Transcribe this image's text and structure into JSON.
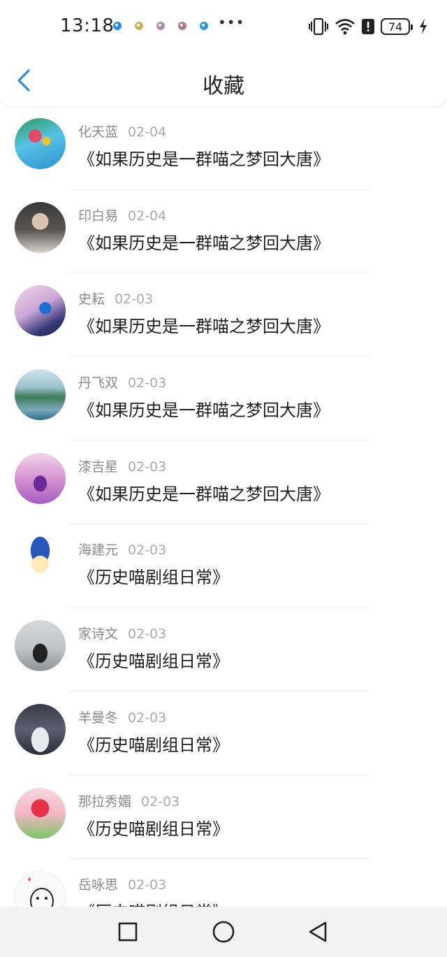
{
  "status_bar": {
    "time": "13:18",
    "overflow": "•••",
    "battery": "74",
    "notification_colors": [
      "#2a8fd6",
      "#c8b15a",
      "#a88ea8",
      "#b07a8a",
      "#2a9ad6"
    ]
  },
  "header": {
    "title": "收藏",
    "back_icon": "chevron-left-icon",
    "accent": "#2f8ee6"
  },
  "favorites": [
    {
      "user": "化天蓝",
      "date": "02-04",
      "book": "《如果历史是一群喵之梦回大唐》"
    },
    {
      "user": "印白易",
      "date": "02-04",
      "book": "《如果历史是一群喵之梦回大唐》"
    },
    {
      "user": "史耘",
      "date": "02-03",
      "book": "《如果历史是一群喵之梦回大唐》"
    },
    {
      "user": "丹飞双",
      "date": "02-03",
      "book": "《如果历史是一群喵之梦回大唐》"
    },
    {
      "user": "漆吉星",
      "date": "02-03",
      "book": "《如果历史是一群喵之梦回大唐》"
    },
    {
      "user": "海建元",
      "date": "02-03",
      "book": "《历史喵剧组日常》"
    },
    {
      "user": "家诗文",
      "date": "02-03",
      "book": "《历史喵剧组日常》"
    },
    {
      "user": "羊曼冬",
      "date": "02-03",
      "book": "《历史喵剧组日常》"
    },
    {
      "user": "那拉秀媚",
      "date": "02-03",
      "book": "《历史喵剧组日常》"
    },
    {
      "user": "岳咏思",
      "date": "02-03",
      "book": "《历史喵剧组日常》"
    }
  ],
  "nav_bar": {
    "recents_icon": "square-icon",
    "home_icon": "circle-icon",
    "back_icon": "triangle-back-icon"
  }
}
